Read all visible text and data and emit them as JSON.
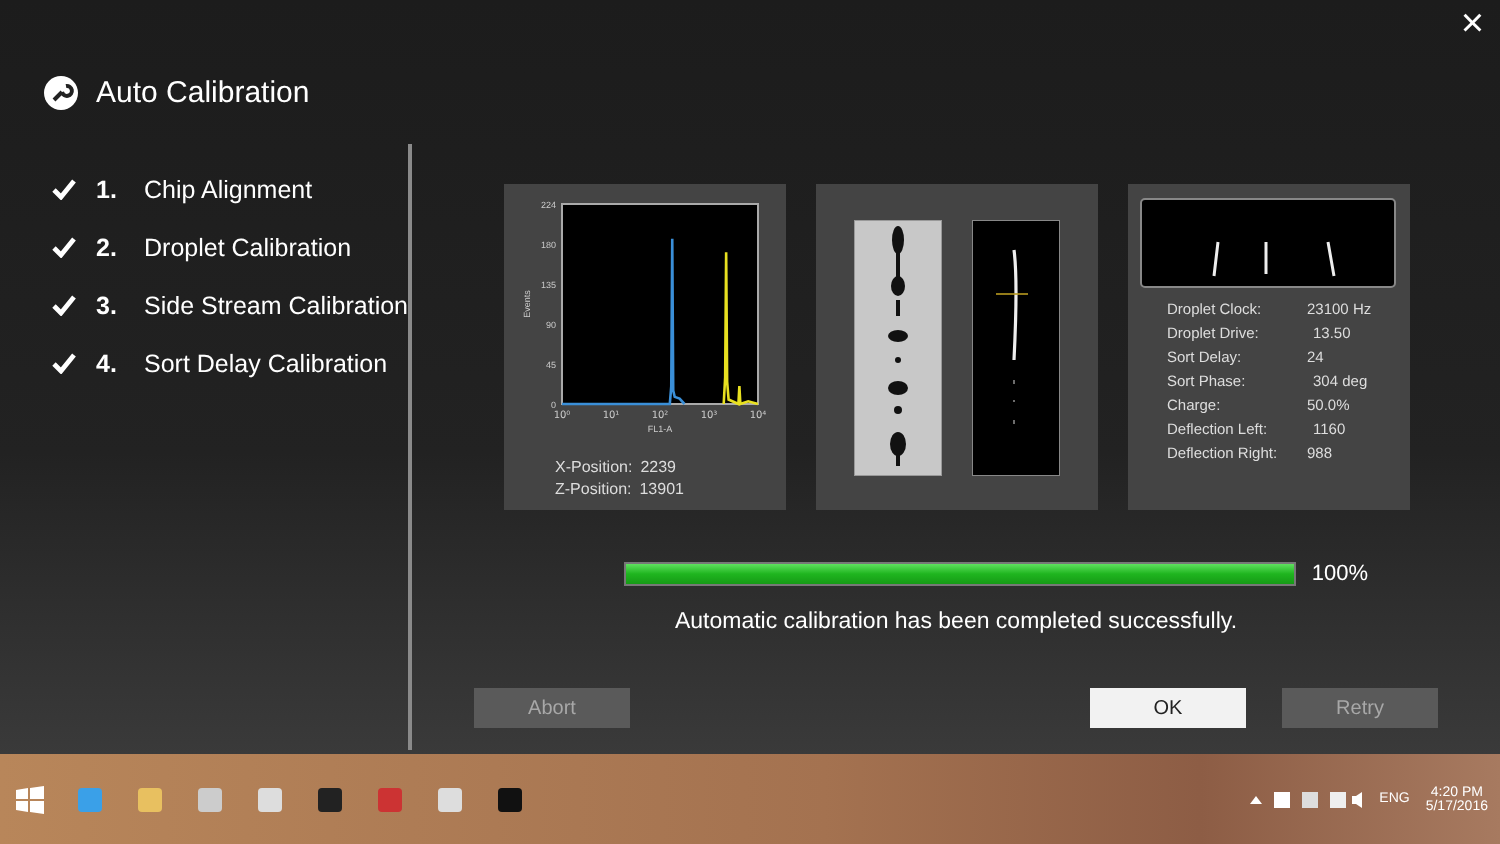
{
  "dialog": {
    "title": "Auto Calibration",
    "close": "×"
  },
  "steps": [
    {
      "number": "1.",
      "label": "Chip Alignment",
      "checked": true
    },
    {
      "number": "2.",
      "label": "Droplet Calibration",
      "checked": true
    },
    {
      "number": "3.",
      "label": "Side Stream Calibration",
      "checked": true
    },
    {
      "number": "4.",
      "label": "Sort Delay Calibration",
      "checked": true
    }
  ],
  "alignment_panel": {
    "histogram": {
      "x_axis_label": "FL1-A",
      "y_axis_label": "Events",
      "x_tick_labels": [
        "10⁰",
        "10¹",
        "10²",
        "10³",
        "10⁴"
      ],
      "y_tick_labels": [
        "224",
        "180",
        "135",
        "90",
        "45",
        "0"
      ]
    },
    "readings": [
      {
        "label": "X-Position:",
        "value": "2239"
      },
      {
        "label": "Z-Position:",
        "value": "13901"
      }
    ]
  },
  "stream_panel": {
    "readings": [
      {
        "label": "Droplet Clock:",
        "value": "23100 Hz"
      },
      {
        "label": "Droplet Drive:",
        "value": "13.50"
      },
      {
        "label": "Sort Delay:",
        "value": "24"
      },
      {
        "label": "Sort Phase:",
        "value": "304 deg"
      },
      {
        "label": "Charge:",
        "value": "50.0%"
      },
      {
        "label": "Deflection Left:",
        "value": "1160"
      },
      {
        "label": "Deflection Right:",
        "value": "988"
      }
    ]
  },
  "progress": {
    "level": 1,
    "reading": "100%"
  },
  "message": "Automatic calibration has been completed successfully.",
  "buttons": [
    {
      "label": "Abort",
      "disabled": true
    },
    {
      "label": "OK",
      "disabled": false
    },
    {
      "label": "Retry",
      "disabled": true
    }
  ],
  "taskbar": {
    "language": "ENG",
    "time": "4:20 PM",
    "date": "5/17/2016"
  }
}
